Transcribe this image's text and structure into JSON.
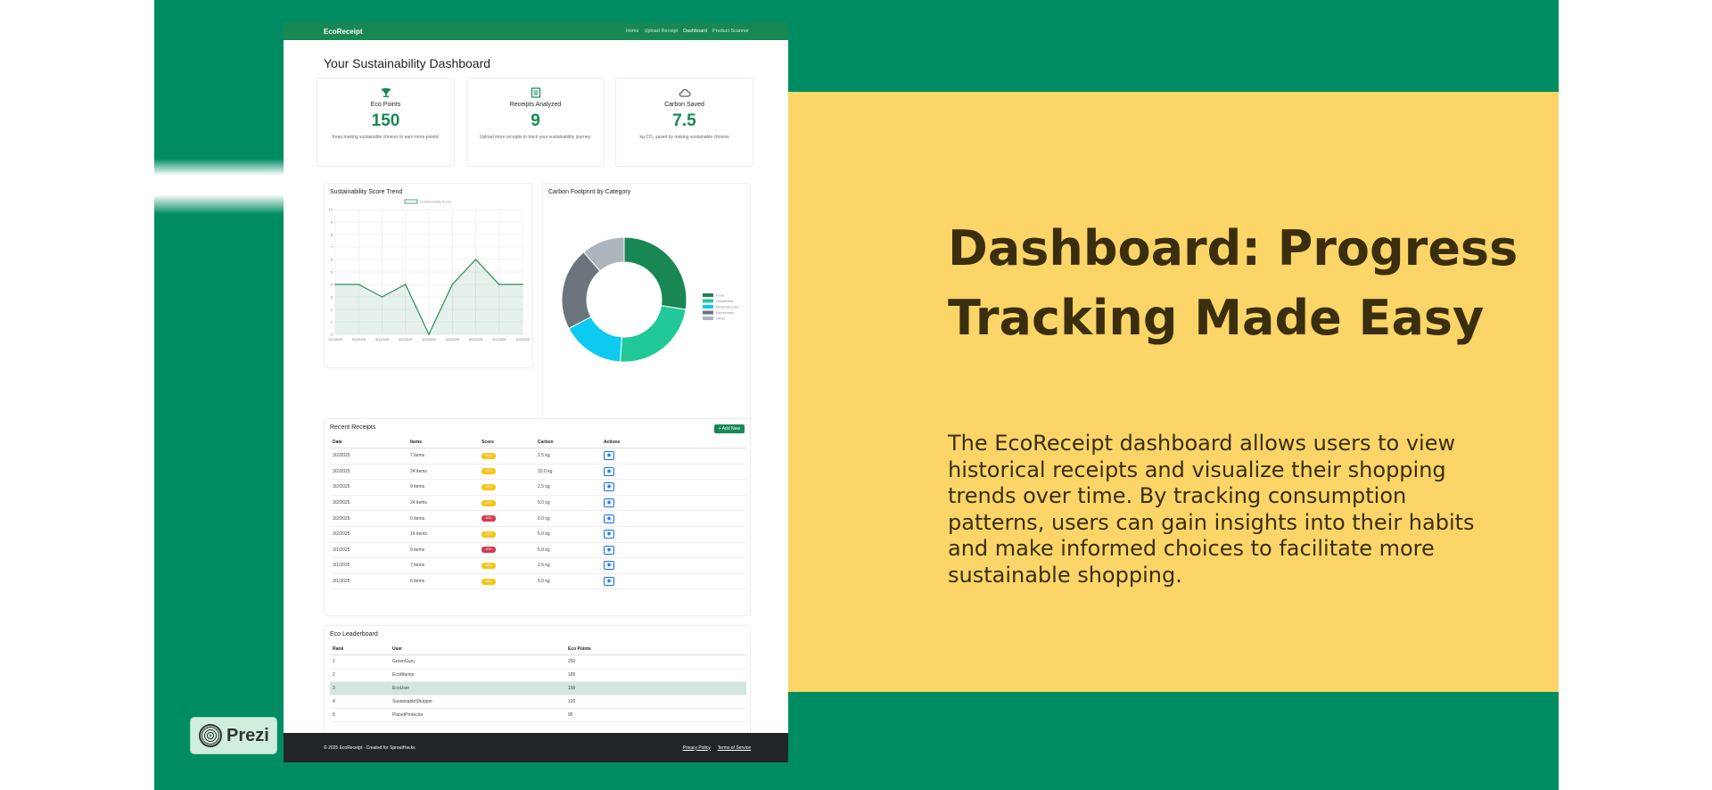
{
  "slide": {
    "title": "Dashboard: Progress Tracking Made Easy",
    "body": "The EcoReceipt dashboard allows users to view historical receipts and visualize their shopping trends over time. By tracking consumption patterns, users can gain insights into their habits and make informed choices to facilitate more sustainable shopping.",
    "prezi_label": "Prezi",
    "colors": {
      "background": "#008c63",
      "panel": "#fbd567",
      "text": "#3a2e0e"
    }
  },
  "app": {
    "brand": "EcoReceipt",
    "nav": [
      "Home",
      "Upload Receipt",
      "Dashboard",
      "Product Scanner"
    ],
    "active_nav": "Dashboard",
    "page_title": "Your Sustainability Dashboard",
    "stats": [
      {
        "icon": "trophy-icon",
        "label": "Eco Points",
        "value": "150",
        "desc": "Keep making sustainable choices to earn more points!"
      },
      {
        "icon": "receipt-icon",
        "label": "Receipts Analyzed",
        "value": "9",
        "desc": "Upload more receipts to track your sustainability journey."
      },
      {
        "icon": "cloud-icon",
        "label": "Carbon Saved",
        "value": "7.5",
        "desc": "kg CO₂ saved by making sustainable choices"
      }
    ],
    "trend_title": "Sustainability Score Trend",
    "donut_title": "Carbon Footprint by Category",
    "receipts": {
      "title": "Recent Receipts",
      "add_label": "+ Add New",
      "headers": [
        "Date",
        "Items",
        "Score",
        "Carbon",
        "Actions"
      ],
      "rows": [
        {
          "date": "3/2/2025",
          "items": "7 items",
          "score": "5/10",
          "level": "warn",
          "carbon": "2.5 kg"
        },
        {
          "date": "3/2/2025",
          "items": "24 items",
          "score": "5/10",
          "level": "warn",
          "carbon": "10.0 kg"
        },
        {
          "date": "3/2/2025",
          "items": "9 items",
          "score": "5/10",
          "level": "warn",
          "carbon": "2.5 kg"
        },
        {
          "date": "3/2/2025",
          "items": "24 items",
          "score": "5/10",
          "level": "warn",
          "carbon": "5.0 kg"
        },
        {
          "date": "3/2/2025",
          "items": "0 items",
          "score": "0/10",
          "level": "danger",
          "carbon": "0.0 kg"
        },
        {
          "date": "3/2/2025",
          "items": "19 items",
          "score": "5/10",
          "level": "warn",
          "carbon": "5.0 kg"
        },
        {
          "date": "3/1/2025",
          "items": "9 items",
          "score": "4/10",
          "level": "danger",
          "carbon": "5.0 kg"
        },
        {
          "date": "3/1/2025",
          "items": "7 items",
          "score": "5/10",
          "level": "warn",
          "carbon": "2.5 kg"
        },
        {
          "date": "3/1/2025",
          "items": "6 items",
          "score": "5/10",
          "level": "warn",
          "carbon": "5.0 kg"
        }
      ]
    },
    "leaderboard": {
      "title": "Eco Leaderboard",
      "headers": [
        "Rank",
        "User",
        "Eco Points"
      ],
      "rows": [
        {
          "rank": "1",
          "user": "GreenGuru",
          "points": "250"
        },
        {
          "rank": "2",
          "user": "EcoWarrior",
          "points": "185"
        },
        {
          "rank": "3",
          "user": "EcoUser",
          "points": "150",
          "highlight": true
        },
        {
          "rank": "4",
          "user": "SustainableShopper",
          "points": "120"
        },
        {
          "rank": "5",
          "user": "PlanetProtector",
          "points": "95"
        }
      ]
    },
    "footer": {
      "copyright": "© 2025 EcoReceipt - Created for SproutHacks",
      "links": [
        "Privacy Policy",
        "Terms of Service"
      ]
    }
  },
  "chart_data": [
    {
      "type": "area",
      "title": "Sustainability Score Trend",
      "series": [
        {
          "name": "Sustainability Score",
          "values": [
            4,
            4,
            3,
            4,
            0,
            4,
            6,
            4,
            4
          ]
        }
      ],
      "x": [
        "3/1/2025",
        "3/1/2025",
        "3/1/2025",
        "3/2/2025",
        "3/2/2025",
        "3/2/2025",
        "3/2/2025",
        "3/2/2025",
        "3/2/2025"
      ],
      "ylim": [
        0,
        10
      ],
      "yticks": [
        0,
        1,
        2,
        3,
        4,
        5,
        6,
        7,
        8,
        9,
        10
      ],
      "grid": true,
      "legend": "top",
      "color": "#2e8b57"
    },
    {
      "type": "pie",
      "title": "Carbon Footprint by Category",
      "categories": [
        "Food",
        "Household",
        "Personal Care",
        "Electronics",
        "Other"
      ],
      "values": [
        27,
        23,
        16,
        21,
        11
      ],
      "colors": [
        "#198754",
        "#20c997",
        "#0dcaf0",
        "#6c757d",
        "#adb5bd"
      ],
      "legend": "right"
    }
  ]
}
